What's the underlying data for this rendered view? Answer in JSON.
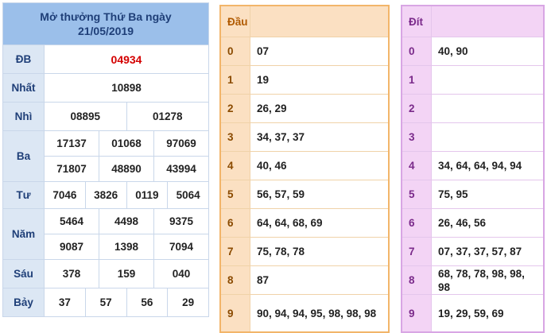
{
  "results": {
    "title_line1": "Mở thưởng Thứ Ba ngày",
    "title_line2": "21/05/2019",
    "db": {
      "label": "ĐB",
      "values": [
        "04934"
      ]
    },
    "nhat": {
      "label": "Nhất",
      "values": [
        "10898"
      ]
    },
    "nhi": {
      "label": "Nhì",
      "values": [
        "08895",
        "01278"
      ]
    },
    "ba": {
      "label": "Ba",
      "values": [
        "17137",
        "01068",
        "97069",
        "71807",
        "48890",
        "43994"
      ]
    },
    "tu": {
      "label": "Tư",
      "values": [
        "7046",
        "3826",
        "0119",
        "5064"
      ]
    },
    "nam": {
      "label": "Năm",
      "values": [
        "5464",
        "4498",
        "9375",
        "9087",
        "1398",
        "7094"
      ]
    },
    "sau": {
      "label": "Sáu",
      "values": [
        "378",
        "159",
        "040"
      ]
    },
    "bay": {
      "label": "Bảy",
      "values": [
        "37",
        "57",
        "56",
        "29"
      ]
    }
  },
  "dau": {
    "header": "Đầu",
    "rows": [
      {
        "k": "0",
        "v": "07"
      },
      {
        "k": "1",
        "v": "19"
      },
      {
        "k": "2",
        "v": "26, 29"
      },
      {
        "k": "3",
        "v": "34, 37, 37"
      },
      {
        "k": "4",
        "v": "40, 46"
      },
      {
        "k": "5",
        "v": "56, 57, 59"
      },
      {
        "k": "6",
        "v": "64, 64, 68, 69"
      },
      {
        "k": "7",
        "v": "75, 78, 78"
      },
      {
        "k": "8",
        "v": "87"
      },
      {
        "k": "9",
        "v": "90, 94, 94, 95, 98, 98, 98"
      }
    ]
  },
  "dit": {
    "header": "Đít",
    "rows": [
      {
        "k": "0",
        "v": "40, 90"
      },
      {
        "k": "1",
        "v": ""
      },
      {
        "k": "2",
        "v": ""
      },
      {
        "k": "3",
        "v": ""
      },
      {
        "k": "4",
        "v": "34, 64, 64, 94, 94"
      },
      {
        "k": "5",
        "v": "75, 95"
      },
      {
        "k": "6",
        "v": "26, 46, 56"
      },
      {
        "k": "7",
        "v": "07, 37, 37, 57, 87"
      },
      {
        "k": "8",
        "v": "68, 78, 78, 98, 98, 98"
      },
      {
        "k": "9",
        "v": "19, 29, 59, 69"
      }
    ]
  }
}
